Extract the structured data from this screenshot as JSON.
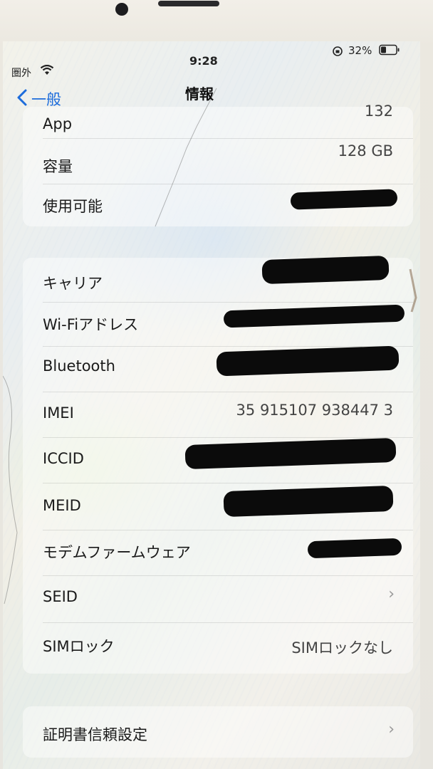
{
  "status_bar": {
    "carrier": "圏外",
    "time": "9:28",
    "battery": "32%"
  },
  "nav": {
    "back_label": "一般",
    "title": "情報"
  },
  "group1": {
    "rows": [
      {
        "label": "App",
        "value": "132"
      },
      {
        "label": "容量",
        "value": "128 GB"
      },
      {
        "label": "使用可能",
        "value": ""
      }
    ]
  },
  "group2": {
    "rows": [
      {
        "label": "キャリア",
        "value": ""
      },
      {
        "label": "Wi-Fiアドレス",
        "value": ""
      },
      {
        "label": "Bluetooth",
        "value": ""
      },
      {
        "label": "IMEI",
        "value": "35 915107 938447 3"
      },
      {
        "label": "ICCID",
        "value": ""
      },
      {
        "label": "MEID",
        "value": ""
      },
      {
        "label": "モデムファームウェア",
        "value": ""
      },
      {
        "label": "SEID",
        "value": ""
      },
      {
        "label": "SIMロック",
        "value": "SIMロックなし"
      }
    ]
  },
  "group3": {
    "rows": [
      {
        "label": "証明書信頼設定",
        "value": ""
      }
    ]
  },
  "icons": {
    "back": "chevron-left-icon",
    "wifi": "wifi-icon",
    "battery": "battery-icon",
    "orientation_lock": "orientation-lock-icon",
    "row_chevron": "chevron-right-icon"
  },
  "colors": {
    "accent": "#1d6cdb",
    "redaction": "#0b0b0b"
  }
}
